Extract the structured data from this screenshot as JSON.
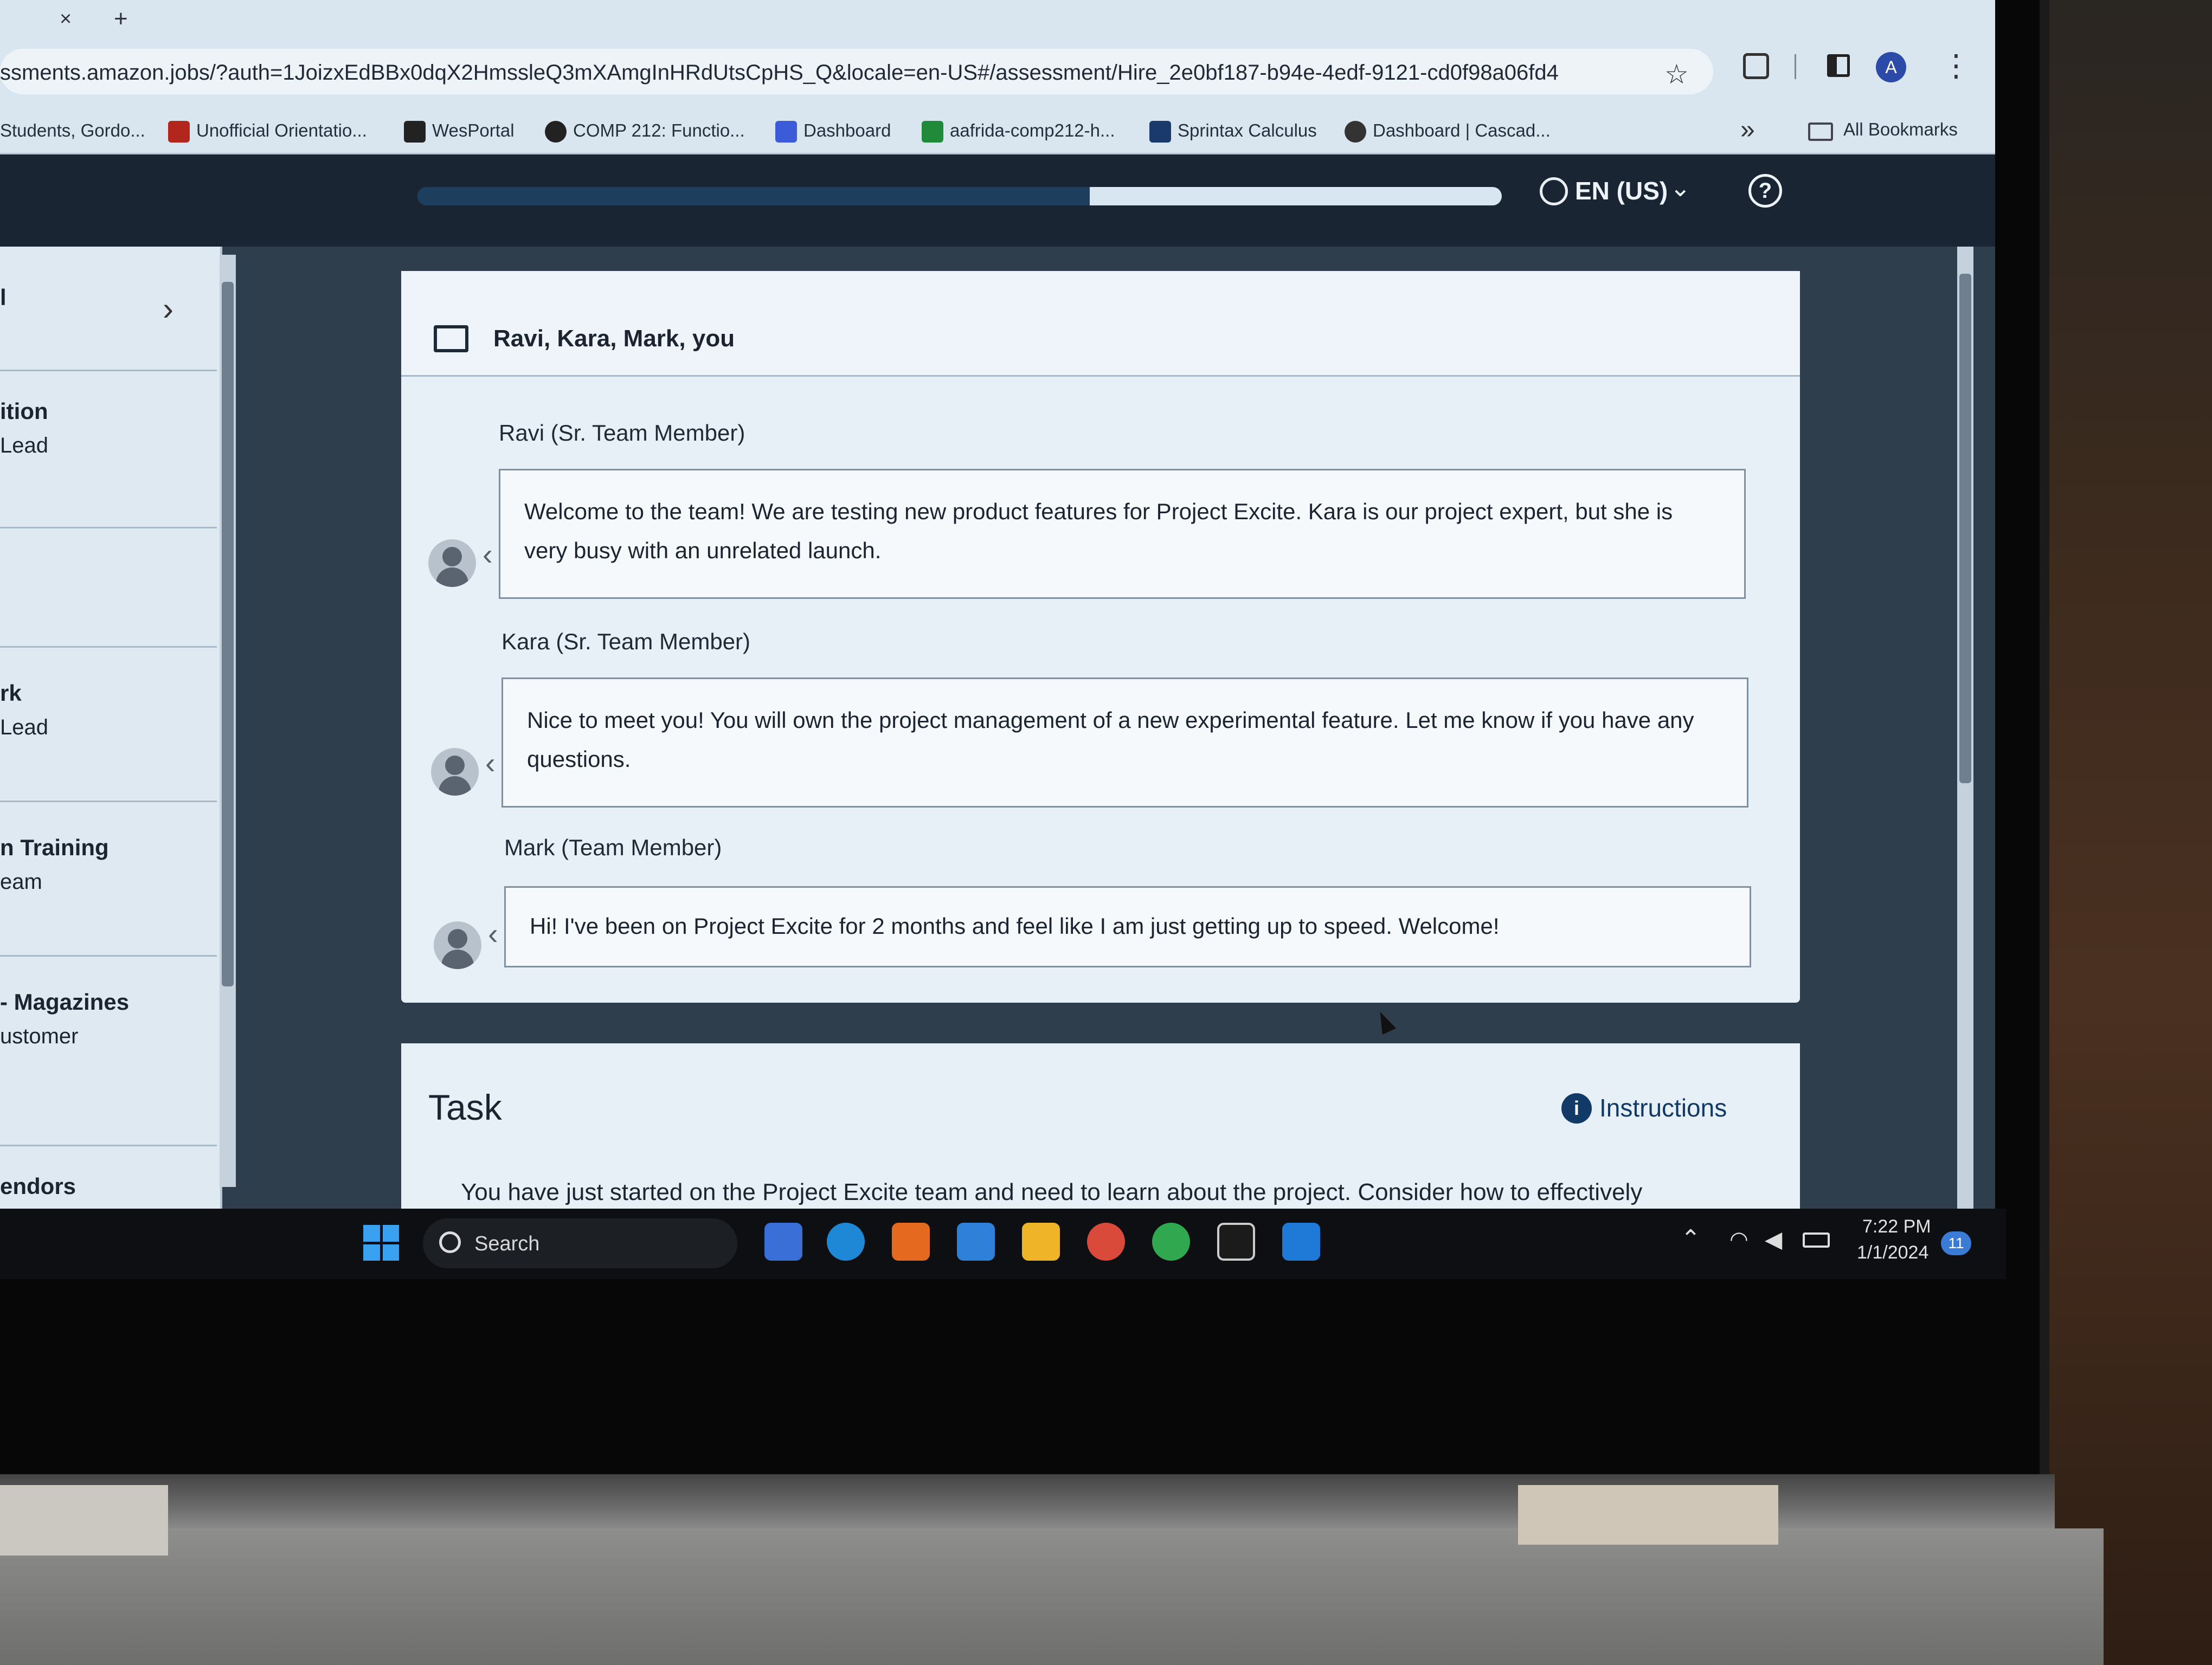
{
  "browser": {
    "tab": {
      "close": "×",
      "new": "+"
    },
    "url": "ssments.amazon.jobs/?auth=1JoizxEdBBx0dqX2HmssleQ3mXAmgInHRdUtsCpHS_Q&locale=en-US#/assessment/Hire_2e0bf187-b94e-4edf-9121-cd0f98a06fd4",
    "avatar_letter": "A",
    "bookmarks": [
      {
        "label": "Students, Gordo...",
        "color": "#8a2b2b"
      },
      {
        "label": "Unofficial Orientatio...",
        "color": "#b3261e"
      },
      {
        "label": "WesPortal",
        "color": "#222222"
      },
      {
        "label": "COMP 212: Functio...",
        "color": "#222222"
      },
      {
        "label": "Dashboard",
        "color": "#3b5bd9"
      },
      {
        "label": "aafrida-comp212-h...",
        "color": "#1f8a3a"
      },
      {
        "label": "Sprintax Calculus",
        "color": "#1a3a6b"
      },
      {
        "label": "Dashboard | Cascad...",
        "color": "#333333"
      }
    ],
    "more": "»",
    "all_bookmarks": "All Bookmarks"
  },
  "header": {
    "progress": 0.62,
    "language": "EN (US)",
    "help": "?"
  },
  "sidebar": {
    "items": [
      {
        "title": "l",
        "sub": ""
      },
      {
        "title": "ition",
        "sub": "Lead"
      },
      {
        "title": "",
        "sub": ""
      },
      {
        "title": "rk",
        "sub": "Lead"
      },
      {
        "title": "n Training",
        "sub": "eam"
      },
      {
        "title": "- Magazines",
        "sub": "ustomer"
      },
      {
        "title": "endors",
        "sub": ""
      }
    ]
  },
  "chat": {
    "title": "Ravi, Kara, Mark, you",
    "messages": [
      {
        "name": "Ravi (Sr. Team Member)",
        "text": "Welcome to the team! We are testing new product features for Project Excite. Kara is our project expert, but she is very busy with an unrelated launch."
      },
      {
        "name": "Kara (Sr. Team Member)",
        "text": "Nice to meet you! You will own the project management of a new experimental feature. Let me know if you have any questions."
      },
      {
        "name": "Mark (Team Member)",
        "text": "Hi! I've been on Project Excite for 2 months and feel like I am just getting up to speed. Welcome!"
      }
    ]
  },
  "task": {
    "title": "Task",
    "instructions_label": "Instructions",
    "body": "You have just started on the Project Excite team and need to learn about the project. Consider how to effectively"
  },
  "taskbar": {
    "search_label": "Search",
    "time": "7:22 PM",
    "date": "1/1/2024",
    "notification_count": "11"
  }
}
